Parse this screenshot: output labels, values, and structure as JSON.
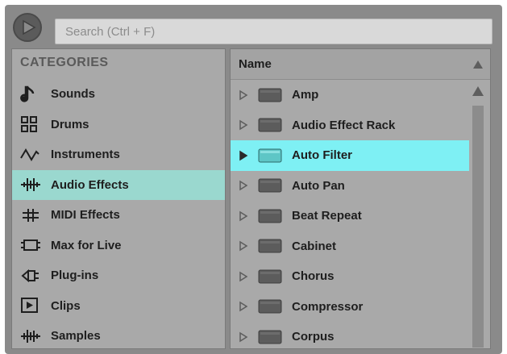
{
  "search": {
    "placeholder": "Search (Ctrl + F)"
  },
  "colors": {
    "selected_category": "#9ad8cf",
    "selected_item": "#7ef0f4"
  },
  "categories": {
    "header": "CATEGORIES",
    "items": [
      {
        "label": "Sounds",
        "icon": "music-note-icon"
      },
      {
        "label": "Drums",
        "icon": "drum-grid-icon"
      },
      {
        "label": "Instruments",
        "icon": "waveform-icon"
      },
      {
        "label": "Audio Effects",
        "icon": "audio-effect-icon",
        "selected": true
      },
      {
        "label": "MIDI Effects",
        "icon": "midi-effect-icon"
      },
      {
        "label": "Max for Live",
        "icon": "max-for-live-icon"
      },
      {
        "label": "Plug-ins",
        "icon": "plugin-icon"
      },
      {
        "label": "Clips",
        "icon": "clip-icon"
      },
      {
        "label": "Samples",
        "icon": "sample-icon"
      }
    ]
  },
  "browser": {
    "column_header": "Name",
    "items": [
      {
        "label": "Amp"
      },
      {
        "label": "Audio Effect Rack"
      },
      {
        "label": "Auto Filter",
        "selected": true
      },
      {
        "label": "Auto Pan"
      },
      {
        "label": "Beat Repeat"
      },
      {
        "label": "Cabinet"
      },
      {
        "label": "Chorus"
      },
      {
        "label": "Compressor"
      },
      {
        "label": "Corpus"
      }
    ]
  }
}
